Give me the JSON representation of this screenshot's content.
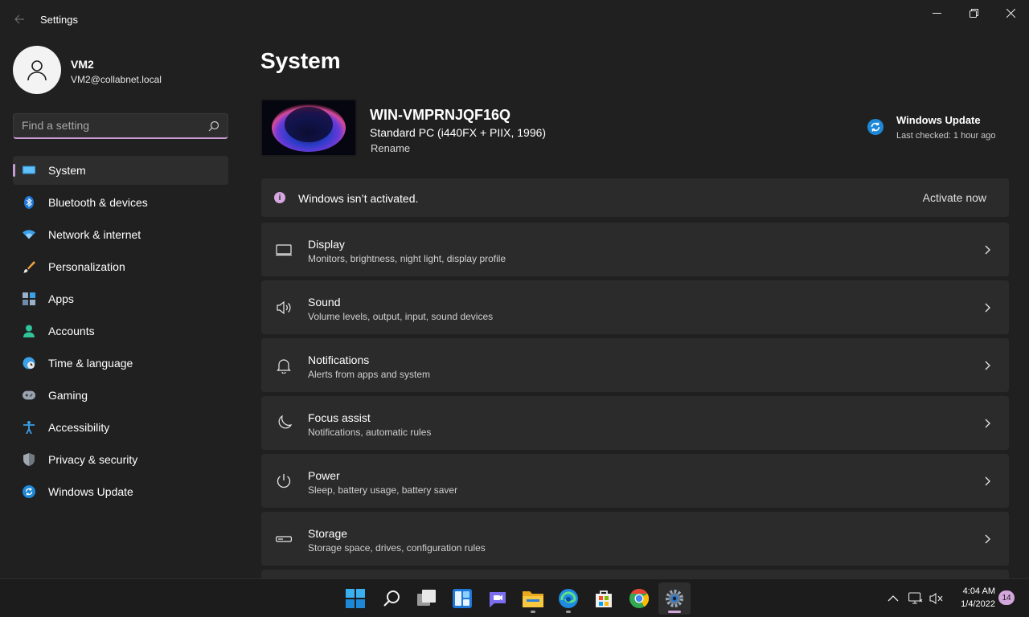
{
  "window": {
    "title": "Settings"
  },
  "profile": {
    "name": "VM2",
    "email": "VM2@collabnet.local"
  },
  "search": {
    "placeholder": "Find a setting"
  },
  "sidebar": {
    "items": [
      {
        "label": "System",
        "icon": "monitor-icon",
        "active": true
      },
      {
        "label": "Bluetooth & devices",
        "icon": "bluetooth-icon"
      },
      {
        "label": "Network & internet",
        "icon": "wifi-icon"
      },
      {
        "label": "Personalization",
        "icon": "brush-icon"
      },
      {
        "label": "Apps",
        "icon": "apps-icon"
      },
      {
        "label": "Accounts",
        "icon": "person-icon"
      },
      {
        "label": "Time & language",
        "icon": "globe-clock-icon"
      },
      {
        "label": "Gaming",
        "icon": "gamepad-icon"
      },
      {
        "label": "Accessibility",
        "icon": "accessibility-icon"
      },
      {
        "label": "Privacy & security",
        "icon": "shield-icon"
      },
      {
        "label": "Windows Update",
        "icon": "update-icon"
      }
    ]
  },
  "main": {
    "title": "System",
    "device": {
      "name": "WIN-VMPRNJQF16Q",
      "model": "Standard PC (i440FX + PIIX, 1996)",
      "rename_label": "Rename"
    },
    "windows_update": {
      "title": "Windows Update",
      "subtitle": "Last checked: 1 hour ago"
    },
    "activation": {
      "message": "Windows isn’t activated.",
      "button_label": "Activate now"
    },
    "cards": [
      {
        "title": "Display",
        "subtitle": "Monitors, brightness, night light, display profile",
        "icon": "display-icon"
      },
      {
        "title": "Sound",
        "subtitle": "Volume levels, output, input, sound devices",
        "icon": "speaker-icon"
      },
      {
        "title": "Notifications",
        "subtitle": "Alerts from apps and system",
        "icon": "bell-icon"
      },
      {
        "title": "Focus assist",
        "subtitle": "Notifications, automatic rules",
        "icon": "moon-icon"
      },
      {
        "title": "Power",
        "subtitle": "Sleep, battery usage, battery saver",
        "icon": "power-icon"
      },
      {
        "title": "Storage",
        "subtitle": "Storage space, drives, configuration rules",
        "icon": "storage-icon"
      }
    ]
  },
  "taskbar": {
    "apps": [
      "start-icon",
      "search-icon",
      "task-view-icon",
      "widgets-icon",
      "teams-chat-icon",
      "file-explorer-icon",
      "edge-icon",
      "store-icon",
      "chrome-icon",
      "settings-icon"
    ],
    "clock": {
      "time": "4:04 AM",
      "date": "1/4/2022"
    },
    "notification_count": "14"
  },
  "colors": {
    "accent": "#d3a7dc",
    "background": "#202020",
    "card": "#2b2b2b"
  }
}
